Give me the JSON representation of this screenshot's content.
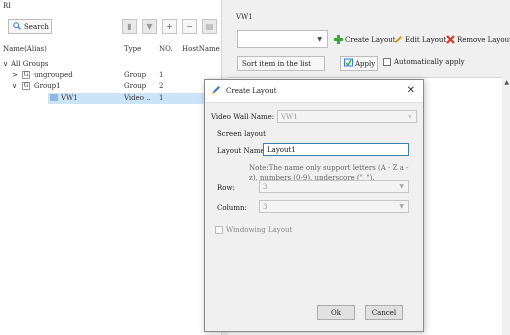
{
  "left_panel": {
    "title": "RI",
    "search_label": "Search",
    "icons": [
      "delete-icon",
      "pin-icon",
      "add-icon",
      "minus-icon",
      "copy-icon"
    ],
    "icon_glyphs": [
      "▮",
      "▼",
      "+",
      "−",
      "▤"
    ],
    "columns": {
      "name": "Name(Alias)",
      "type": "Type",
      "no": "NO.",
      "hostname": "HostName"
    },
    "tree": [
      {
        "expander": "∨",
        "badge": "",
        "name": "All Groups",
        "type": "",
        "no": ""
      },
      {
        "expander": ">",
        "badge": "G",
        "name": "ungrouped",
        "type": "Group",
        "no": "1"
      },
      {
        "expander": "∨",
        "badge": "G",
        "name": "Group1",
        "type": "Group",
        "no": "2"
      },
      {
        "expander": "",
        "badge": "vw",
        "name": "VW1",
        "type": "Video ..",
        "no": "1"
      }
    ]
  },
  "right_panel": {
    "title": "VW1",
    "create_layout": "Create Layout",
    "edit_layout": "Edit Layout",
    "remove_layout": "Remove Layout",
    "sort_label": "Sort item in the list",
    "apply_label": "Apply",
    "auto_apply_label": "Automatically apply",
    "colors": {
      "create": "#3aa83a",
      "edit": "#d4a017",
      "remove": "#d93a2b"
    }
  },
  "dialog": {
    "title": "Create Layout",
    "video_wall_label": "Video Wall Name:",
    "video_wall_value": "VW1",
    "screen_layout_label": "Screen layout",
    "layout_name_label": "Layout Name:",
    "layout_name_value": "Layout1",
    "note": "Note:The name only support letters (A - Z a - z), numbers (0-9), underscore (\"_\").",
    "row_label": "Row:",
    "row_value": "3",
    "column_label": "Column:",
    "column_value": "3",
    "windowing_label": "Windowing Layout",
    "ok_label": "Ok",
    "cancel_label": "Cancel"
  }
}
